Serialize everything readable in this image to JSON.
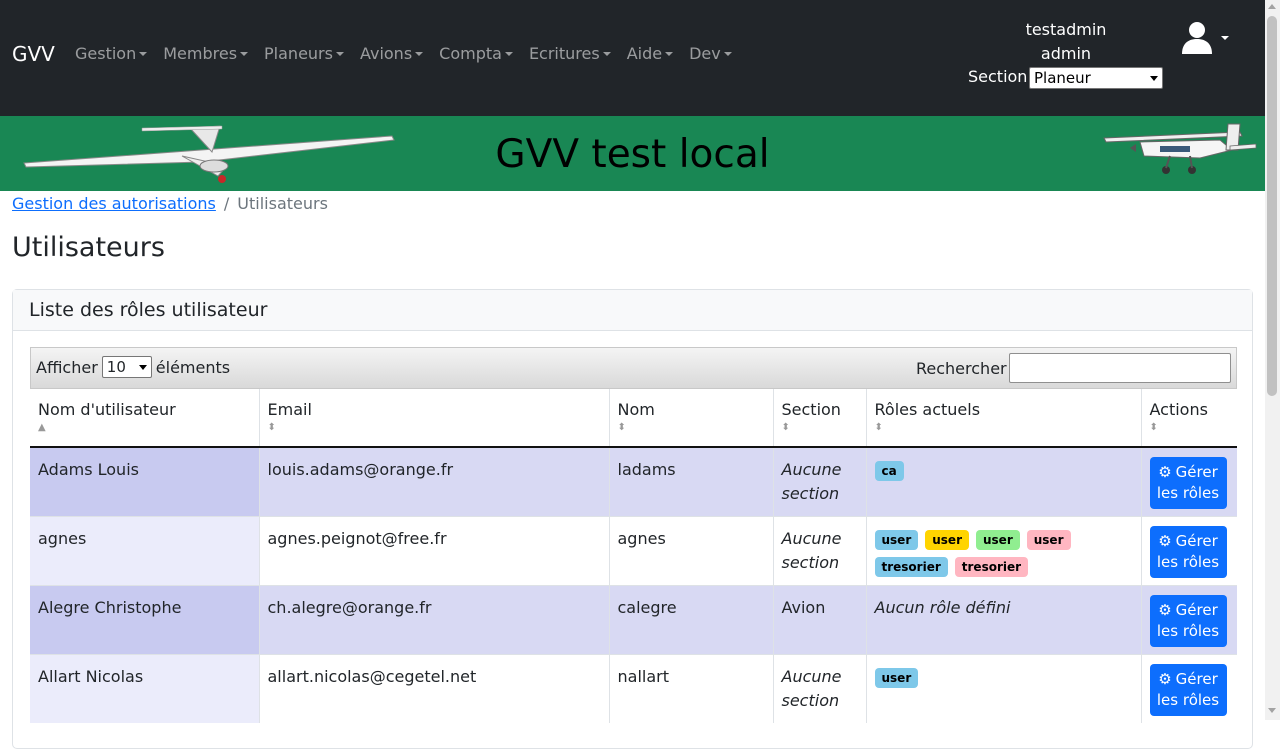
{
  "navbar": {
    "brand": "GVV",
    "menu": [
      {
        "label": "Gestion"
      },
      {
        "label": "Membres"
      },
      {
        "label": "Planeurs"
      },
      {
        "label": "Avions"
      },
      {
        "label": "Compta"
      },
      {
        "label": "Ecritures"
      },
      {
        "label": "Aide"
      },
      {
        "label": "Dev"
      }
    ],
    "username": "testadmin",
    "role": "admin",
    "section_label": "Section:",
    "section_value": "Planeur",
    "avatar_icon": "user-icon"
  },
  "banner": {
    "title": "GVV test local",
    "left_image": "glider-image",
    "right_image": "airplane-image"
  },
  "breadcrumb": {
    "parent": "Gestion des autorisations",
    "separator": "/",
    "current": "Utilisateurs"
  },
  "page": {
    "title": "Utilisateurs"
  },
  "card": {
    "header": "Liste des rôles utilisateur",
    "length_prefix": "Afficher",
    "length_value": "10",
    "length_suffix": "éléments",
    "search_label": "Rechercher :",
    "search_value": ""
  },
  "table": {
    "columns": [
      "Nom d'utilisateur",
      "Email",
      "Nom",
      "Section",
      "Rôles actuels",
      "Actions"
    ],
    "action_label_1": "Gérer",
    "action_label_2": "les rôles",
    "rows": [
      {
        "user": "Adams Louis",
        "email": "louis.adams@orange.fr",
        "login": "ladams",
        "section_line1": "Aucune",
        "section_line2": "section",
        "section_italic": true,
        "roles_text": "",
        "roles": [
          {
            "label": "ca",
            "color": "#7ec8e9"
          }
        ]
      },
      {
        "user": "agnes",
        "email": "agnes.peignot@free.fr",
        "login": "agnes",
        "section_line1": "Aucune",
        "section_line2": "section",
        "section_italic": true,
        "roles_text": "",
        "roles": [
          {
            "label": "user",
            "color": "#7ec8e9"
          },
          {
            "label": "user",
            "color": "#ffd400"
          },
          {
            "label": "user",
            "color": "#90ee90"
          },
          {
            "label": "user",
            "color": "#ffb6c1"
          },
          {
            "label": "tresorier",
            "color": "#7ec8e9"
          },
          {
            "label": "tresorier",
            "color": "#ffb6c1"
          }
        ]
      },
      {
        "user": "Alegre Christophe",
        "email": "ch.alegre@orange.fr",
        "login": "calegre",
        "section_line1": "Avion",
        "section_line2": "",
        "section_italic": false,
        "roles_text": "Aucun rôle défini",
        "roles": []
      },
      {
        "user": "Allart Nicolas",
        "email": "allart.nicolas@cegetel.net",
        "login": "nallart",
        "section_line1": "Aucune",
        "section_line2": "section",
        "section_italic": true,
        "roles_text": "",
        "roles": [
          {
            "label": "user",
            "color": "#7ec8e9"
          }
        ]
      }
    ]
  }
}
